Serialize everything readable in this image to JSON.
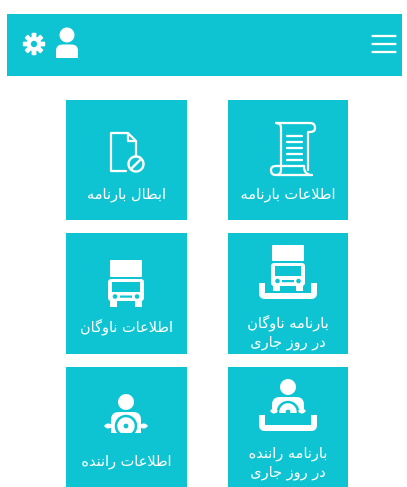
{
  "header": {
    "background": "#0ec4d2",
    "icons": [
      "gear-icon",
      "user-icon",
      "hamburger-menu-icon"
    ]
  },
  "tiles": [
    {
      "label": "اطلاعات بارنامه",
      "icon": "document-scroll-icon"
    },
    {
      "label": "ابطال بارنامه",
      "icon": "document-cancel-icon"
    },
    {
      "label_line1": "بارنامه ناوگان",
      "label_line2": "در روز جاری",
      "icon": "truck-tray-icon"
    },
    {
      "label": "اطلاعات ناوگان",
      "icon": "truck-icon"
    },
    {
      "label_line1": "بارنامه راننده",
      "label_line2": "در روز جاری",
      "icon": "driver-tray-icon"
    },
    {
      "label": "اطلاعات راننده",
      "icon": "driver-steering-icon"
    }
  ]
}
